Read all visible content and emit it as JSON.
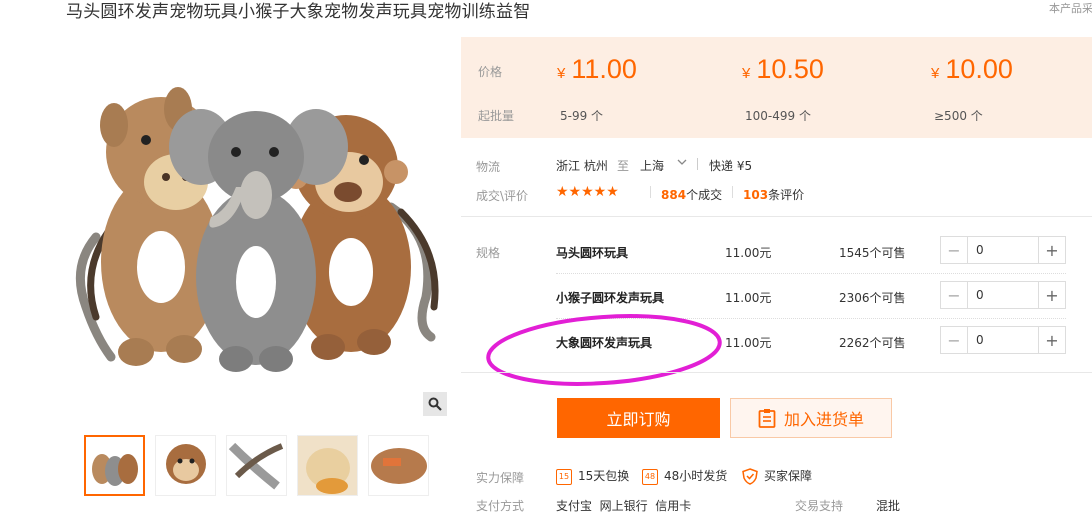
{
  "product": {
    "title": "马头圆环发声宠物玩具小猴子大象宠物发声玩具宠物训练益智",
    "corner_note": "本产品采"
  },
  "price_panel": {
    "price_label": "价格",
    "moq_label": "起批量",
    "currency": "¥",
    "tiers": [
      {
        "price": "11.00",
        "moq": "5-99 个"
      },
      {
        "price": "10.50",
        "moq": "100-499 个"
      },
      {
        "price": "10.00",
        "moq": "≥500 个"
      }
    ]
  },
  "logistics": {
    "label": "物流",
    "from": "浙江 杭州",
    "to_word": "至",
    "to": "上海",
    "express": "快递 ¥5"
  },
  "deals": {
    "label": "成交\\评价",
    "stars": "★★★★★",
    "deal_count": "884",
    "deal_suffix": "个成交",
    "review_count": "103",
    "review_suffix": "条评价"
  },
  "sku": {
    "label": "规格",
    "items": [
      {
        "name": "马头圆环玩具",
        "price": "11.00元",
        "stock": "1545个可售",
        "qty": "0"
      },
      {
        "name": "小猴子圆环发声玩具",
        "price": "11.00元",
        "stock": "2306个可售",
        "qty": "0"
      },
      {
        "name": "大象圆环发声玩具",
        "price": "11.00元",
        "stock": "2262个可售",
        "qty": "0"
      }
    ]
  },
  "actions": {
    "buy_now": "立即订购",
    "add_to_cart": "加入进货单"
  },
  "guarantee": {
    "label": "实力保障",
    "items": [
      {
        "icon": "15",
        "text": "15天包换"
      },
      {
        "icon": "48",
        "text": "48小时发货"
      },
      {
        "icon": "shield",
        "text": "买家保障"
      }
    ]
  },
  "payment": {
    "label": "支付方式",
    "methods": "支付宝  网上银行  信用卡",
    "trade_label": "交易支持",
    "trade_value": "混批"
  },
  "colors": {
    "accent": "#ff6600",
    "price_bg": "#fdeee3",
    "annotation": "#e21fd5"
  }
}
